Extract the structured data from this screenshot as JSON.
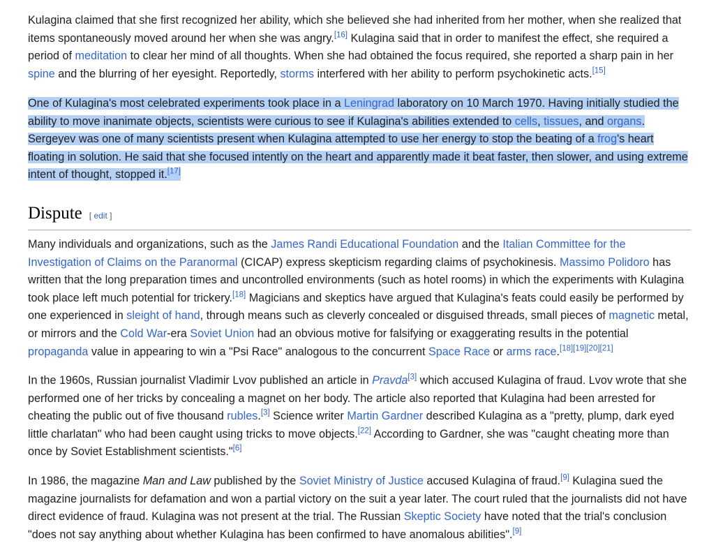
{
  "p1": {
    "t1": "Kulagina claimed that she first recognized her ability, which she believed she had inherited from her mother, when she realized that items spontaneously moved around her when she was angry.",
    "ref1": "[16]",
    "t2": " Kulagina said that in order to manifest the effect, she required a period of ",
    "link_meditation": "meditation",
    "t3": " to clear her mind of all thoughts. When she had obtained the focus required, she reported a sharp pain in her ",
    "link_spine": "spine",
    "t4": " and the blurring of her eyesight. Reportedly, ",
    "link_storms": "storms",
    "t5": " interfered with her ability to perform psychokinetic acts.",
    "ref2": "[15]"
  },
  "p2": {
    "t1": "One of Kulagina's most celebrated experiments took place in a ",
    "link_leningrad": "Leningrad",
    "t2": " laboratory on 10 March 1970. Having initially studied the ability to move inanimate objects, scientists were curious to see if Kulagina's abilities extended to ",
    "link_cells": "cells",
    "c1": ", ",
    "link_tissues": "tissues",
    "c2": ", and ",
    "link_organs": "organs",
    "t3": ". Sergeyev was one of many scientists present when Kulagina attempted to use her energy to stop the beating of a ",
    "link_frog": "frog",
    "t4": "'s heart floating in solution. He said that she focused intently on the heart and apparently made it beat faster, then slower, and using extreme intent of thought, stopped it.",
    "ref": "[17]"
  },
  "heading": {
    "title": "Dispute",
    "edit_open": "[ ",
    "edit": "edit",
    "edit_close": " ]"
  },
  "p3": {
    "t1": "Many individuals and organizations, such as the ",
    "link_randi": "James Randi Educational Foundation",
    "t2": " and the ",
    "link_cicap": "Italian Committee for the Investigation of Claims on the Paranormal",
    "t3": " (CICAP) express skepticism regarding claims of psychokinesis. ",
    "link_polidoro": "Massimo Polidoro",
    "t4": " has written that the long preparation times and uncontrolled environments (such as hotel rooms) in which the experiments with Kulagina took place left much potential for trickery.",
    "ref1": "[18]",
    "t5": " Magicians and skeptics have argued that Kulagina's feats could easily be performed by one experienced in ",
    "link_sleight": "sleight of hand",
    "t6": ", through means such as cleverly concealed or disguised threads, small pieces of ",
    "link_magnetic": "magnetic",
    "t7": " metal, or mirrors and the ",
    "link_coldwar": "Cold War",
    "t8": "-era ",
    "link_soviet": "Soviet Union",
    "t9": " had an obvious motive for falsifying or exaggerating results in the potential ",
    "link_propaganda": "propaganda",
    "t10": " value in appearing to win a \"Psi Race\" analogous to the concurrent ",
    "link_space": "Space Race",
    "t11": " or ",
    "link_arms": "arms race",
    "t12": ".",
    "ref2": "[18][19][20][21]"
  },
  "p4": {
    "t1": "In the 1960s, Russian journalist Vladimir Lvov published an article in ",
    "link_pravda": "Pravda",
    "ref1": "[3]",
    "t2": " which accused Kulagina of fraud. Lvov wrote that she performed one of her tricks by concealing a magnet on her body. The article also reported that Kulagina had been arrested for cheating the public out of five thousand ",
    "link_rubles": "rubles",
    "t3": ".",
    "ref2": "[3]",
    "t4": " Science writer ",
    "link_gardner": "Martin Gardner",
    "t5": " described Kulagina as a \"pretty, plump, dark eyed little charlatan\" who had been caught using tricks to move objects.",
    "ref3": "[22]",
    "t6": " According to Gardner, she was \"caught cheating more than once by Soviet Establishment scientists.\"",
    "ref4": "[6]"
  },
  "p5": {
    "t1": "In 1986, the magazine ",
    "em": "Man and Law",
    "t2": " published by the ",
    "link_ministry": "Soviet Ministry of Justice",
    "t3": " accused Kulagina of fraud.",
    "ref1": "[9]",
    "t4": " Kulagina sued the magazine journalists for defamation and won a partial victory on the suit a year later. The court ruled that the journalists did not have direct evidence of fraud. Kulagina was not present at the trial. The Russian ",
    "link_skeptic": "Skeptic Society",
    "t5": " have noted that the trial's conclusion \"does not say anything about whether Kulagina has been confirmed to have anomalous abilities\".",
    "ref2": "[9]"
  }
}
